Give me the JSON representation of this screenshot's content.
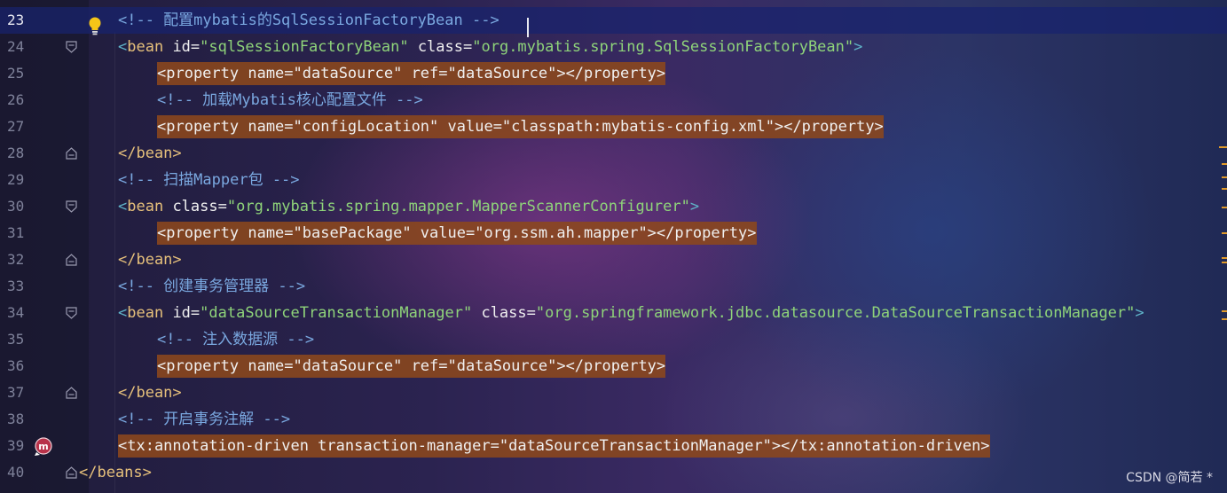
{
  "editor": {
    "current_line": "23",
    "lines": [
      {
        "no": "23",
        "kind": "comment",
        "text": "<!-- 配置mybatis的SqlSessionFactoryBean -->"
      },
      {
        "no": "24",
        "kind": "open",
        "tag": "bean",
        "a1": " id",
        "eq1": "=",
        "v1": "\"sqlSessionFactoryBean\"",
        "a2": " class",
        "eq2": "=",
        "v2": "\"org.mybatis.spring.SqlSessionFactoryBean\"",
        "close": ">"
      },
      {
        "no": "25",
        "kind": "hl",
        "text": "<property name=\"dataSource\" ref=\"dataSource\"></property>"
      },
      {
        "no": "26",
        "kind": "comment",
        "text": "<!-- 加载Mybatis核心配置文件 -->"
      },
      {
        "no": "27",
        "kind": "hl",
        "text": "<property name=\"configLocation\" value=\"classpath:mybatis-config.xml\"></property>"
      },
      {
        "no": "28",
        "kind": "end",
        "text": "</bean>"
      },
      {
        "no": "29",
        "kind": "comment",
        "text": "<!-- 扫描Mapper包 -->"
      },
      {
        "no": "30",
        "kind": "open",
        "tag": "bean",
        "a1": " class",
        "eq1": "=",
        "v1": "\"org.mybatis.spring.mapper.MapperScannerConfigurer\"",
        "a2": "",
        "eq2": "",
        "v2": "",
        "close": ">"
      },
      {
        "no": "31",
        "kind": "hl",
        "text": "<property name=\"basePackage\" value=\"org.ssm.ah.mapper\"></property>"
      },
      {
        "no": "32",
        "kind": "end",
        "text": "</bean>"
      },
      {
        "no": "33",
        "kind": "comment",
        "text": "<!-- 创建事务管理器 -->"
      },
      {
        "no": "34",
        "kind": "open",
        "tag": "bean",
        "a1": " id",
        "eq1": "=",
        "v1": "\"dataSourceTransactionManager\"",
        "a2": " class",
        "eq2": "=",
        "v2": "\"org.springframework.jdbc.datasource.DataSourceTransactionManager\"",
        "close": ">"
      },
      {
        "no": "35",
        "kind": "comment",
        "text": "<!-- 注入数据源 -->"
      },
      {
        "no": "36",
        "kind": "hl",
        "text": "<property name=\"dataSource\" ref=\"dataSource\"></property>"
      },
      {
        "no": "37",
        "kind": "end",
        "text": "</bean>"
      },
      {
        "no": "38",
        "kind": "comment",
        "text": "<!-- 开启事务注解 -->"
      },
      {
        "no": "39",
        "kind": "hl",
        "text": "<tx:annotation-driven transaction-manager=\"dataSourceTransactionManager\"></tx:annotation-driven>"
      },
      {
        "no": "40",
        "kind": "end",
        "text": "</beans>"
      }
    ]
  },
  "watermark": "CSDN @简若 *",
  "colors": {
    "tag": "#e6c07b",
    "string": "#8fd47a",
    "comment": "#7aa8e0",
    "highlight": "#8c481c",
    "current_line": "#18226e",
    "error_marks": "#e09a2a"
  },
  "icons": {
    "line_23": "lightbulb-icon",
    "line_39": "mybatis-mapper-icon",
    "fold": "fold-marker-icon"
  }
}
